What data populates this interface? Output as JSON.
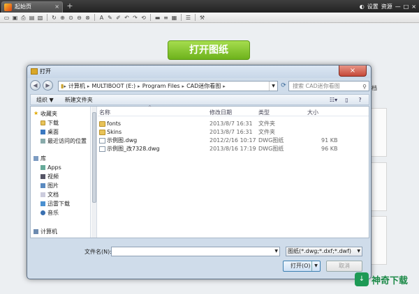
{
  "app": {
    "tab_title": "起始页",
    "tab_close": "×",
    "new_tab": "+",
    "right_links": [
      "设置",
      "资源"
    ],
    "window_controls": [
      "—",
      "□",
      "×"
    ]
  },
  "main": {
    "open_button": "打开图纸",
    "bg_tab_fragment": "档"
  },
  "dialog": {
    "title": "打开",
    "close": "×",
    "nav": {
      "back": "◀",
      "forward": "▶"
    },
    "breadcrumb": [
      "计算机",
      "MULTIBOOT (E:)",
      "Program Files",
      "CAD迷你看图"
    ],
    "search_placeholder": "搜索 CAD迷你看图",
    "commands": {
      "organize": "组织 ▼",
      "new_folder": "新建文件夹"
    },
    "nav_pane": {
      "favorites": {
        "label": "收藏夹",
        "items": [
          "下载",
          "桌面",
          "最近访问的位置"
        ]
      },
      "libraries": {
        "label": "库",
        "items": [
          "Apps",
          "视频",
          "图片",
          "文档",
          "迅雷下载",
          "音乐"
        ]
      },
      "computer": {
        "label": "计算机"
      }
    },
    "columns": {
      "name": "名称",
      "modified": "修改日期",
      "type": "类型",
      "size": "大小"
    },
    "files": [
      {
        "name": "fonts",
        "modified": "2013/8/7 16:31",
        "type": "文件夹",
        "size": "",
        "kind": "folder"
      },
      {
        "name": "Skins",
        "modified": "2013/8/7 16:31",
        "type": "文件夹",
        "size": "",
        "kind": "folder"
      },
      {
        "name": "示例图.dwg",
        "modified": "2012/2/16 10:17",
        "type": "DWG图纸",
        "size": "91 KB",
        "kind": "dwg"
      },
      {
        "name": "示例图_改7328.dwg",
        "modified": "2013/8/16 17:19",
        "type": "DWG图纸",
        "size": "96 KB",
        "kind": "dwg"
      }
    ],
    "filename_label": "文件名(N):",
    "filename_value": "",
    "filter_value": "图纸(*.dwg;*.dxf;*.dwf)",
    "open_label": "打开(O)",
    "cancel_label": "取消"
  },
  "watermark": {
    "text": "神奇下载"
  }
}
